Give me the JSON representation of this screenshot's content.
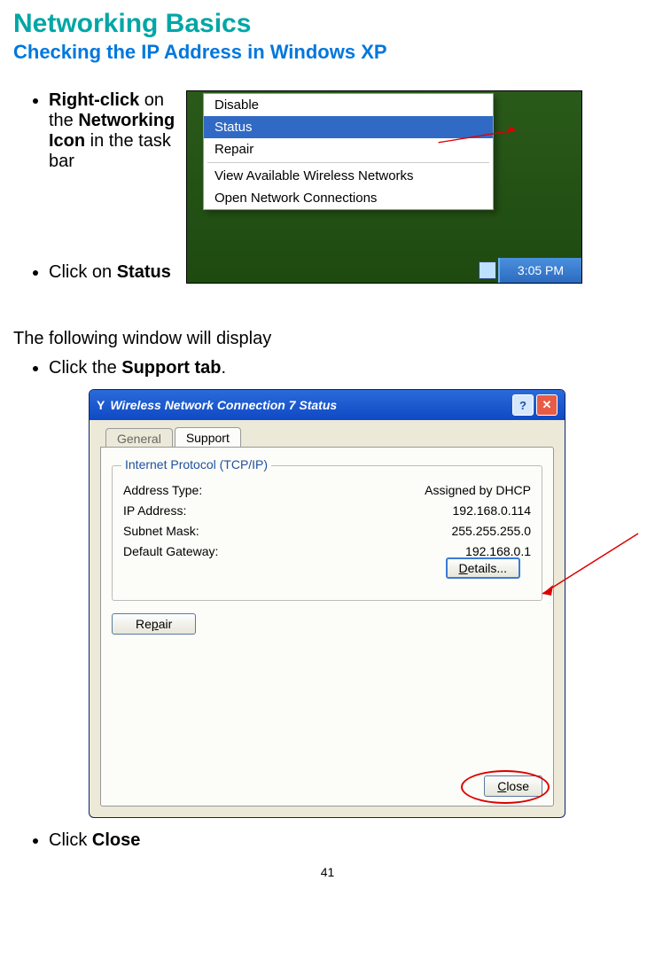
{
  "heading": {
    "title": "Networking Basics",
    "subtitle": "Checking the IP Address in Windows XP"
  },
  "step1_pre": "Right-click",
  "step1_mid": " on the ",
  "step1_bold2": "Networking Icon",
  "step1_post": " in the task bar",
  "step2_pre": "Click on ",
  "step2_bold": "Status",
  "context_menu": {
    "items": [
      "Disable",
      "Status",
      "Repair",
      "View Available Wireless Networks",
      "Open Network Connections"
    ]
  },
  "taskbar_time": "3:05 PM",
  "middle_text": "The following window will display",
  "step3_pre": "Click the ",
  "step3_bold": "Support tab",
  "step3_post": ".",
  "dialog": {
    "title": "Wireless Network Connection 7 Status",
    "tabs": {
      "general": "General",
      "support": "Support"
    },
    "group_title": "Internet Protocol (TCP/IP)",
    "rows": {
      "addr_type_lbl": "Address Type:",
      "addr_type_val": "Assigned by DHCP",
      "ip_lbl": "IP Address:",
      "ip_val": "192.168.0.114",
      "mask_lbl": "Subnet Mask:",
      "mask_val": "255.255.255.0",
      "gw_lbl": "Default Gateway:",
      "gw_val": "192.168.0.1"
    },
    "details_btn": "Details...",
    "repair_btn": "Repair",
    "close_btn": "Close"
  },
  "step4_pre": "Click ",
  "step4_bold": "Close",
  "page_number": "41"
}
